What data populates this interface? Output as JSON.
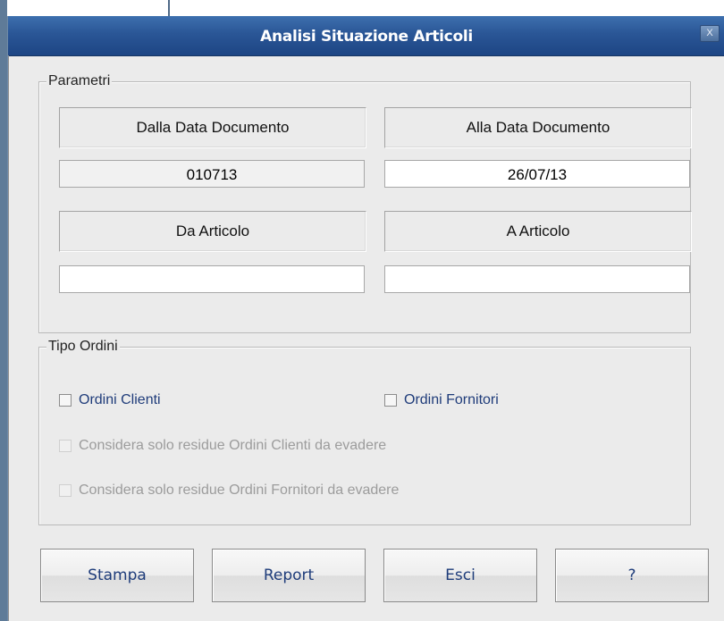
{
  "window": {
    "title": "Analisi Situazione Articoli",
    "close_label": "X"
  },
  "parametri": {
    "legend": "Parametri",
    "dalla_data_label": "Dalla Data Documento",
    "alla_data_label": "Alla Data Documento",
    "dalla_data_value": "010713",
    "alla_data_value": "26/07/13",
    "da_articolo_label": "Da Articolo",
    "a_articolo_label": "A Articolo",
    "da_articolo_value": "",
    "a_articolo_value": ""
  },
  "tipo_ordini": {
    "legend": "Tipo Ordini",
    "ordini_clienti": "Ordini Clienti",
    "ordini_fornitori": "Ordini Fornitori",
    "residue_clienti": "Considera solo residue Ordini Clienti da evadere",
    "residue_fornitori": "Considera solo residue Ordini Fornitori da evadere"
  },
  "buttons": {
    "stampa": "Stampa",
    "report": "Report",
    "esci": "Esci",
    "help": "?"
  }
}
